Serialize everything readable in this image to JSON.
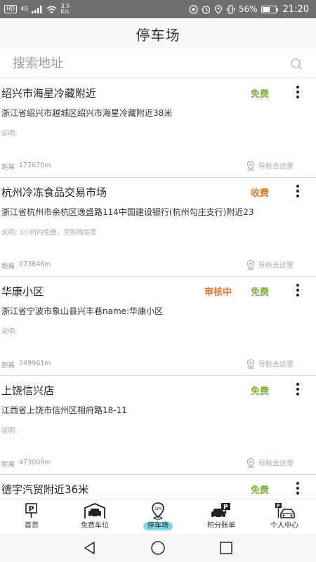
{
  "status_bar": {
    "network_badge": "HD",
    "signal_label": "4G",
    "speed_value": "3.5",
    "speed_unit": "K/s",
    "battery_percent": "56%",
    "battery_level": 0.56,
    "time": "21:20"
  },
  "header": {
    "title": "停车场"
  },
  "search": {
    "placeholder": "搜索地址"
  },
  "lots": [
    {
      "name": "绍兴市海星冷藏附近",
      "fee": "免费",
      "fee_type": "free",
      "review": "",
      "address": "浙江省绍兴市越城区绍兴市海星冷藏附近38米",
      "note": "说明:",
      "distance_label": "距离",
      "distance": "172670m",
      "nav_label": "导航去这里"
    },
    {
      "name": "杭州冷冻食品交易市场",
      "fee": "收费",
      "fee_type": "paid",
      "review": "",
      "address": "浙江省杭州市余杭区逸盛路114中国建设银行(杭州勾庄支行)附近23",
      "note": "说明: 3小时内免费，凭购物发票",
      "distance_label": "距离",
      "distance": "173846m",
      "nav_label": "导航去这里"
    },
    {
      "name": "华康小区",
      "fee": "免费",
      "fee_type": "free",
      "review": "审核中",
      "address": "浙江省宁波市象山县兴丰巷name:华康小区",
      "note": "说明:",
      "distance_label": "距离",
      "distance": "249961m",
      "nav_label": "导航去这里"
    },
    {
      "name": "上饶信兴店",
      "fee": "免费",
      "fee_type": "free",
      "review": "",
      "address": "江西省上饶市信州区相府路18-11",
      "note": "说明:",
      "distance_label": "距离",
      "distance": "473009m",
      "nav_label": "导航去这里"
    },
    {
      "name": "德宇汽贸附近36米",
      "fee": "免费",
      "fee_type": "free",
      "review": ""
    }
  ],
  "tabs": [
    {
      "label": "首页",
      "icon": "parking-sign-icon"
    },
    {
      "label": "免费车位",
      "icon": "garage-car-icon"
    },
    {
      "label": "停车场",
      "icon": "location-pin-icon",
      "active": true
    },
    {
      "label": "积分账单",
      "icon": "car-parking-icon"
    },
    {
      "label": "个人中心",
      "icon": "car-parking-sign-icon"
    }
  ],
  "colors": {
    "free": "#7ab43a",
    "paid": "#e0782c",
    "active_tab_bg": "#7fd8e6",
    "status_bar_bg": "#6f6f6f"
  }
}
